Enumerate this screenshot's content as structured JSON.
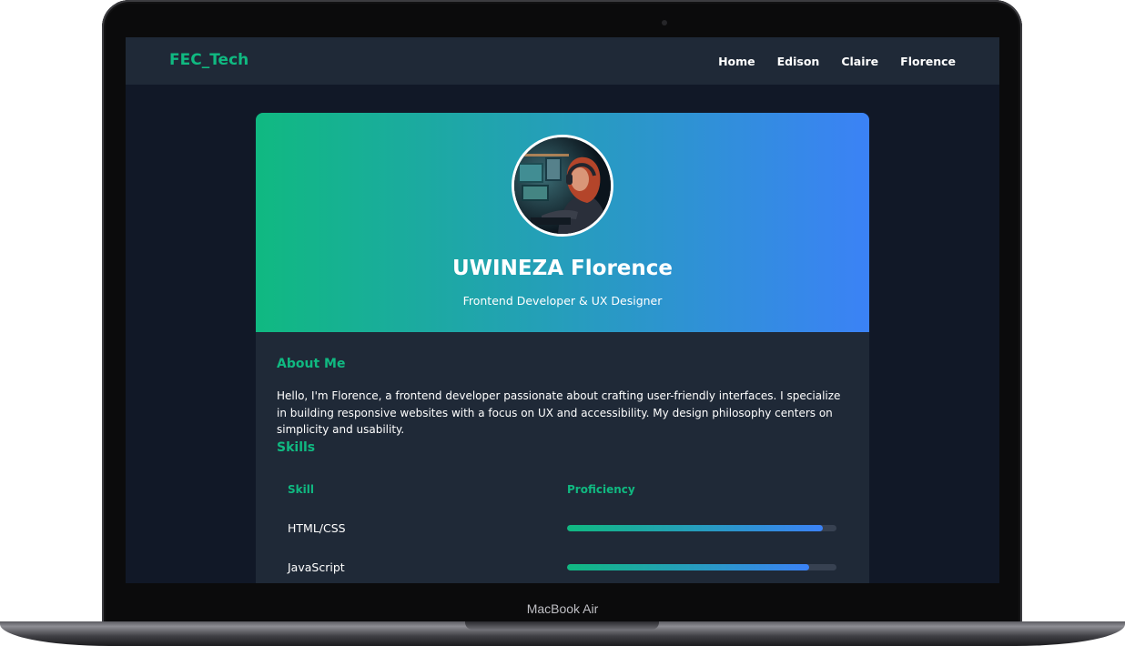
{
  "device": {
    "label": "MacBook Air"
  },
  "navbar": {
    "brand": "FEC_Tech",
    "links": [
      "Home",
      "Edison",
      "Claire",
      "Florence"
    ]
  },
  "profile": {
    "name": "UWINEZA Florence",
    "role": "Frontend Developer & UX Designer",
    "avatar_icon": "person-at-computer-photo"
  },
  "about": {
    "title": "About Me",
    "text": "Hello, I'm Florence, a frontend developer passionate about crafting user-friendly interfaces. I specialize in building responsive websites with a focus on UX and accessibility. My design philosophy centers on simplicity and usability."
  },
  "skills": {
    "title": "Skills",
    "headers": [
      "Skill",
      "Proficiency"
    ],
    "rows": [
      {
        "skill": "HTML/CSS",
        "proficiency": 0.95
      },
      {
        "skill": "JavaScript",
        "proficiency": 0.9
      }
    ]
  },
  "colors": {
    "accent": "#10b981",
    "gradient_end": "#3b82f6",
    "background": "#111827",
    "panel": "#1f2937"
  }
}
